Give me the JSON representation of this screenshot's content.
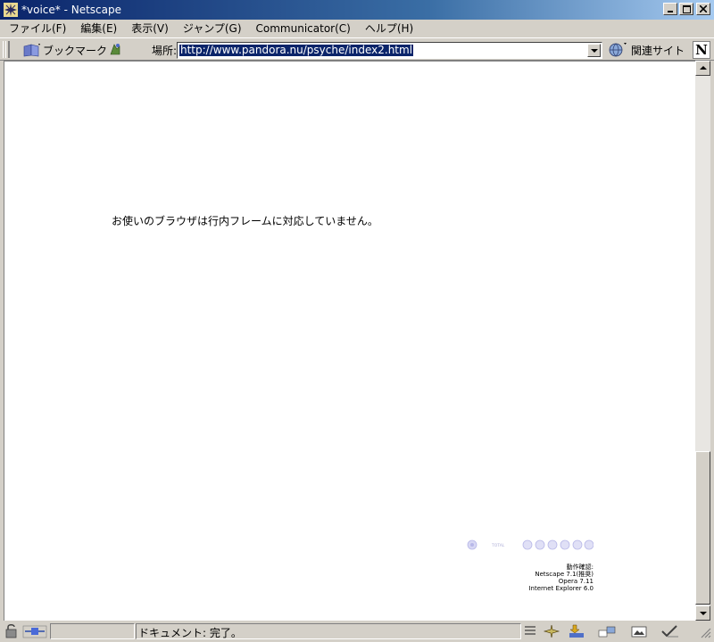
{
  "window": {
    "title": "*voice* - Netscape",
    "controls": [
      "minimize",
      "maximize",
      "close"
    ]
  },
  "menu": {
    "items": [
      "ファイル(F)",
      "編集(E)",
      "表示(V)",
      "ジャンプ(G)",
      "Communicator(C)",
      "ヘルプ(H)"
    ]
  },
  "toolbar": {
    "bookmarks_label": "ブックマーク",
    "location_label": "場所:",
    "url": "http://www.pandora.nu/psyche/index2.html",
    "related_label": "関連サイト"
  },
  "content": {
    "no_iframe_message": "お使いのブラウザは行内フレームに対応していません。",
    "counter_label": "TOTAL",
    "credits": {
      "heading": "動作確認:",
      "lines": [
        "Netscape 7.1(推奨)",
        "Opera 7.11",
        "Internet Explorer 6.0"
      ]
    }
  },
  "statusbar": {
    "status_text": "ドキュメント: 完了。"
  },
  "icons": {
    "app": "netscape-app-icon",
    "bookmark": "bookmark-icon",
    "goto": "goto-icon",
    "related": "related-sites-icon",
    "brand": "netscape-n-logo",
    "security": "lock-icon",
    "connection": "plug-icon"
  },
  "colors": {
    "title_bar": "#0a246a",
    "chrome": "#d4d0c8",
    "selection": "#0a246a",
    "counter_accent": "#c8c8f0"
  }
}
